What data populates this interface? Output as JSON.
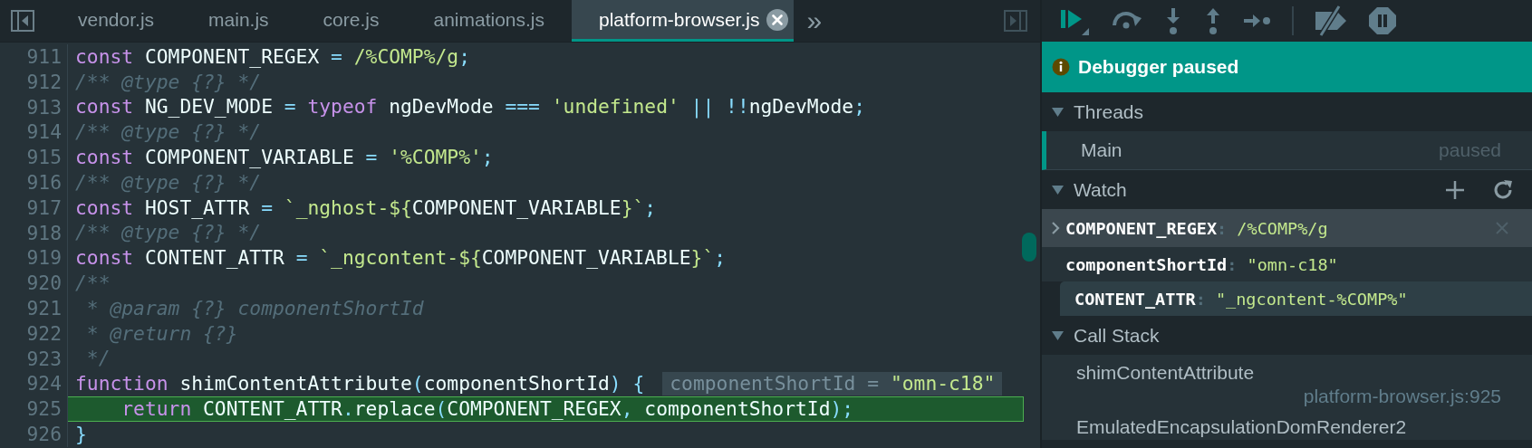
{
  "tabs": [
    {
      "label": "vendor.js",
      "selected": false
    },
    {
      "label": "main.js",
      "selected": false
    },
    {
      "label": "core.js",
      "selected": false
    },
    {
      "label": "animations.js",
      "selected": false
    },
    {
      "label": "platform-browser.js",
      "selected": true
    }
  ],
  "more_tabs": "»",
  "editor": {
    "lines": [
      {
        "number": "911",
        "highlighted": false,
        "tokens": [
          {
            "kind": "kw",
            "text": "const"
          },
          {
            "kind": "id",
            "text": " COMPONENT_REGEX "
          },
          {
            "kind": "op",
            "text": "= "
          },
          {
            "kind": "str",
            "text": "/%COMP%/g"
          },
          {
            "kind": "op",
            "text": ";"
          }
        ]
      },
      {
        "number": "912",
        "highlighted": false,
        "tokens": [
          {
            "kind": "com",
            "text": "/** @type {?} */"
          }
        ]
      },
      {
        "number": "913",
        "highlighted": false,
        "tokens": [
          {
            "kind": "kw",
            "text": "const"
          },
          {
            "kind": "id",
            "text": " NG_DEV_MODE "
          },
          {
            "kind": "op",
            "text": "= "
          },
          {
            "kind": "kw",
            "text": "typeof"
          },
          {
            "kind": "id",
            "text": " ngDevMode "
          },
          {
            "kind": "op",
            "text": "=== "
          },
          {
            "kind": "str",
            "text": "'undefined'"
          },
          {
            "kind": "op",
            "text": " || !!"
          },
          {
            "kind": "id",
            "text": "ngDevMode"
          },
          {
            "kind": "op",
            "text": ";"
          }
        ]
      },
      {
        "number": "914",
        "highlighted": false,
        "tokens": [
          {
            "kind": "com",
            "text": "/** @type {?} */"
          }
        ]
      },
      {
        "number": "915",
        "highlighted": false,
        "tokens": [
          {
            "kind": "kw",
            "text": "const"
          },
          {
            "kind": "id",
            "text": " COMPONENT_VARIABLE "
          },
          {
            "kind": "op",
            "text": "= "
          },
          {
            "kind": "str",
            "text": "'%COMP%'"
          },
          {
            "kind": "op",
            "text": ";"
          }
        ]
      },
      {
        "number": "916",
        "highlighted": false,
        "tokens": [
          {
            "kind": "com",
            "text": "/** @type {?} */"
          }
        ]
      },
      {
        "number": "917",
        "highlighted": false,
        "tokens": [
          {
            "kind": "kw",
            "text": "const"
          },
          {
            "kind": "id",
            "text": " HOST_ATTR "
          },
          {
            "kind": "op",
            "text": "= "
          },
          {
            "kind": "str",
            "text": "`_nghost-${"
          },
          {
            "kind": "id",
            "text": "COMPONENT_VARIABLE"
          },
          {
            "kind": "str",
            "text": "}`"
          },
          {
            "kind": "op",
            "text": ";"
          }
        ]
      },
      {
        "number": "918",
        "highlighted": false,
        "tokens": [
          {
            "kind": "com",
            "text": "/** @type {?} */"
          }
        ]
      },
      {
        "number": "919",
        "highlighted": false,
        "tokens": [
          {
            "kind": "kw",
            "text": "const"
          },
          {
            "kind": "id",
            "text": " CONTENT_ATTR "
          },
          {
            "kind": "op",
            "text": "= "
          },
          {
            "kind": "str",
            "text": "`_ngcontent-${"
          },
          {
            "kind": "id",
            "text": "COMPONENT_VARIABLE"
          },
          {
            "kind": "str",
            "text": "}`"
          },
          {
            "kind": "op",
            "text": ";"
          }
        ]
      },
      {
        "number": "920",
        "highlighted": false,
        "tokens": [
          {
            "kind": "com",
            "text": "/**"
          }
        ]
      },
      {
        "number": "921",
        "highlighted": false,
        "tokens": [
          {
            "kind": "com",
            "text": " * @param {?} componentShortId"
          }
        ]
      },
      {
        "number": "922",
        "highlighted": false,
        "tokens": [
          {
            "kind": "com",
            "text": " * @return {?}"
          }
        ]
      },
      {
        "number": "923",
        "highlighted": false,
        "tokens": [
          {
            "kind": "com",
            "text": " */"
          }
        ]
      },
      {
        "number": "924",
        "highlighted": false,
        "tokens": [
          {
            "kind": "kw",
            "text": "function"
          },
          {
            "kind": "id",
            "text": " shimContentAttribute"
          },
          {
            "kind": "op",
            "text": "("
          },
          {
            "kind": "id",
            "text": "componentShortId"
          },
          {
            "kind": "op",
            "text": ") {"
          }
        ],
        "inline_value": {
          "name": "componentShortId",
          "separator": "=",
          "value": "\"omn-c18\""
        }
      },
      {
        "number": "925",
        "highlighted": true,
        "tokens": [
          {
            "kind": "kw",
            "text": "    return"
          },
          {
            "kind": "id",
            "text": " CONTENT_ATTR"
          },
          {
            "kind": "op",
            "text": "."
          },
          {
            "kind": "id",
            "text": "replace"
          },
          {
            "kind": "op",
            "text": "("
          },
          {
            "kind": "id",
            "text": "COMPONENT_REGEX"
          },
          {
            "kind": "op",
            "text": ","
          },
          {
            "kind": "id",
            "text": " componentShortId"
          },
          {
            "kind": "op",
            "text": ");"
          }
        ]
      },
      {
        "number": "926",
        "highlighted": false,
        "tokens": [
          {
            "kind": "op",
            "text": "}"
          }
        ]
      }
    ]
  },
  "debugger": {
    "banner": "Debugger paused",
    "threads": {
      "title": "Threads",
      "expanded": true,
      "items": [
        {
          "name": "Main",
          "status": "paused",
          "selected": true
        }
      ]
    },
    "watch": {
      "title": "Watch",
      "expanded": true,
      "items": [
        {
          "expression": "COMPONENT_REGEX",
          "separator": ":",
          "value": "/%COMP%/g",
          "selected": true,
          "hovered": false,
          "expandable": true
        },
        {
          "expression": "componentShortId",
          "separator": ":",
          "value": "\"omn-c18\"",
          "selected": false,
          "hovered": false,
          "expandable": false
        },
        {
          "expression": "CONTENT_ATTR",
          "separator": ":",
          "value": "\"_ngcontent-%COMP%\"",
          "selected": false,
          "hovered": true,
          "expandable": false
        }
      ]
    },
    "call_stack": {
      "title": "Call Stack",
      "expanded": true,
      "frames": [
        {
          "function": "shimContentAttribute",
          "location": "platform-browser.js:925"
        },
        {
          "function": "EmulatedEncapsulationDomRenderer2"
        }
      ]
    }
  }
}
